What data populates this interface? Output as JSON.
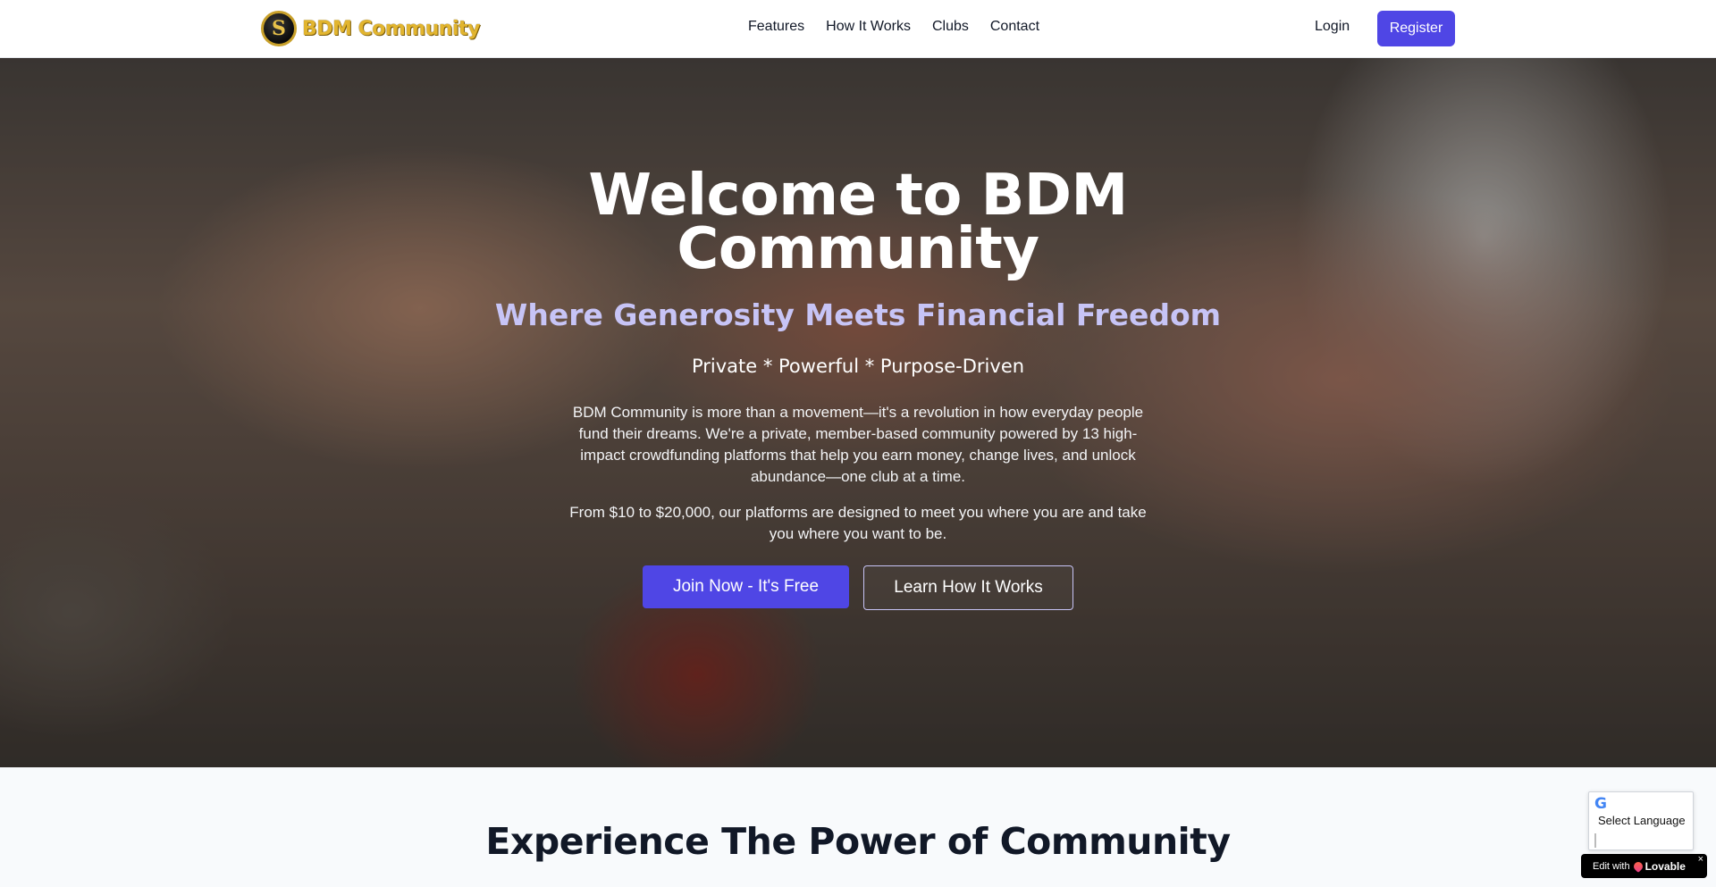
{
  "header": {
    "logo_text": "BDM Community",
    "logo_mark": "S",
    "nav": [
      "Features",
      "How It Works",
      "Clubs",
      "Contact"
    ],
    "login_label": "Login",
    "register_label": "Register"
  },
  "hero": {
    "title": "Welcome to BDM Community",
    "subtitle": "Where Generosity Meets Financial Freedom",
    "tagline": "Private * Powerful * Purpose-Driven",
    "description": "BDM Community is more than a movement—it's a revolution in how everyday people fund their dreams. We're a private, member-based community powered by 13 high-impact crowdfunding platforms that help you earn money, change lives, and unlock abundance—one club at a time.",
    "range_text": "From $10 to $20,000, our platforms are designed to meet you where you are and take you where you want to be.",
    "join_label": "Join Now - It's Free",
    "learn_label": "Learn How It Works"
  },
  "section": {
    "title": "Experience The Power of Community"
  },
  "widgets": {
    "language_label": "Select Language",
    "google_icon": "G",
    "lovable_prefix": "Edit with",
    "lovable_brand": "Lovable",
    "lovable_close": "×"
  },
  "colors": {
    "accent": "#4f46e5",
    "subtitle": "#c7c4f6",
    "logo_gold": "#e2b52f"
  }
}
